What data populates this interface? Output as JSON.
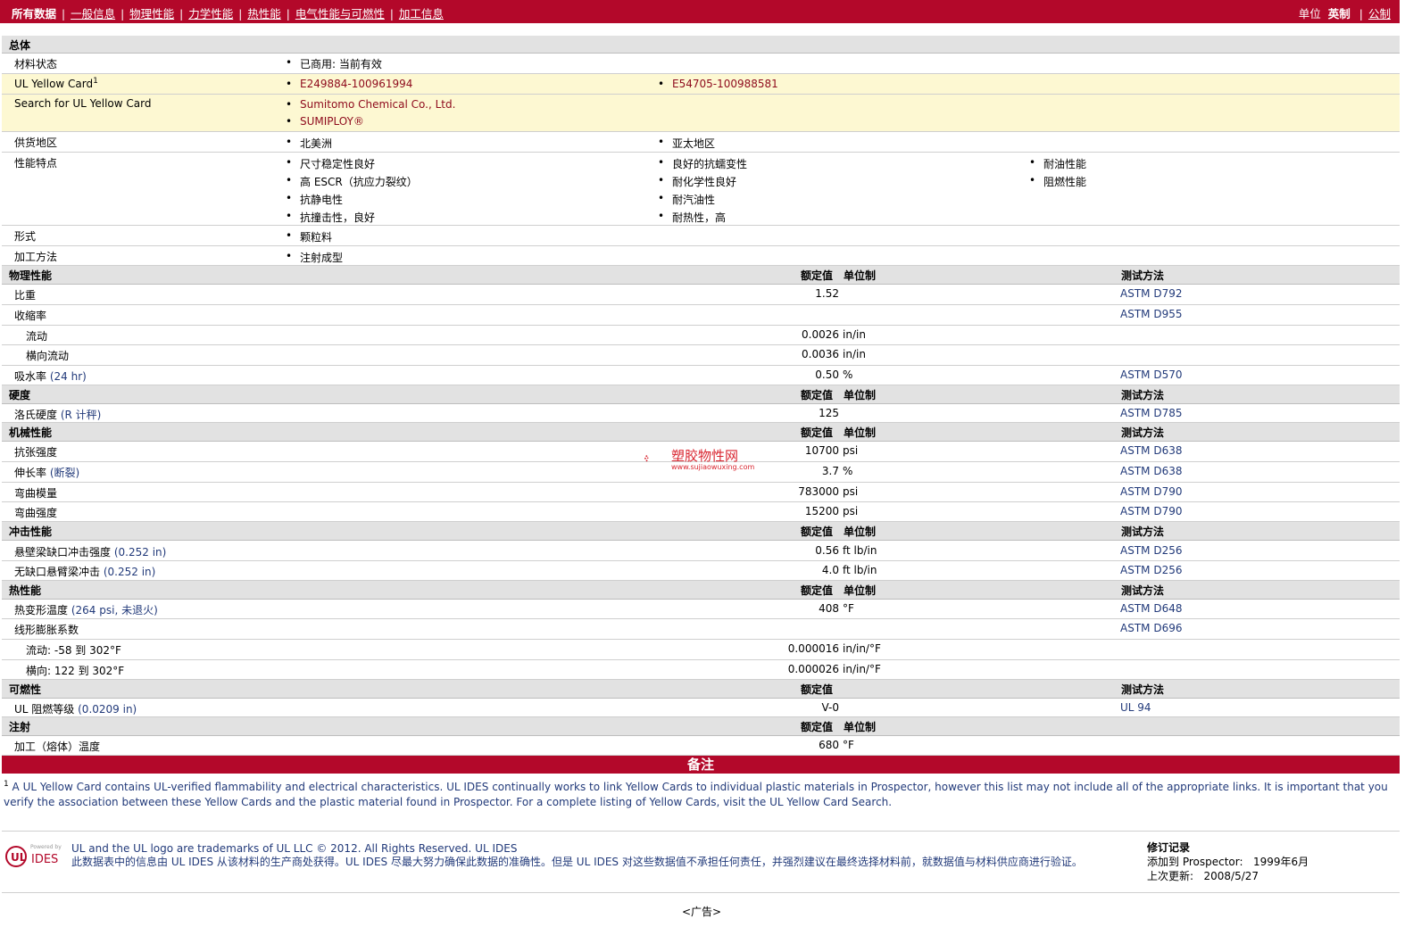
{
  "nav": {
    "tabs": [
      "所有数据",
      "一般信息",
      "物理性能",
      "力学性能",
      "热性能",
      "电气性能与可燃性",
      "加工信息"
    ],
    "units_label": "单位",
    "unit_active": "英制",
    "unit_other": "公制"
  },
  "general": {
    "title": "总体",
    "material_status": {
      "label": "材料状态",
      "value": "已商用: 当前有效"
    },
    "yellow_card": {
      "label": "UL Yellow Card",
      "sup": "1",
      "links": [
        "E249884-100961994",
        "E54705-100988581"
      ]
    },
    "search_card": {
      "label": "Search for UL Yellow Card",
      "links": [
        "Sumitomo Chemical Co., Ltd.",
        "SUMIPLOY®"
      ]
    },
    "supply_region": {
      "label": "供货地区",
      "values": [
        "北美洲",
        "亚太地区"
      ]
    },
    "features": {
      "label": "性能特点",
      "col1": [
        "尺寸稳定性良好",
        "高  ESCR（抗应力裂纹）",
        "抗静电性",
        "抗撞击性，良好"
      ],
      "col2": [
        "良好的抗蠕变性",
        "耐化学性良好",
        "耐汽油性",
        "耐热性，高"
      ],
      "col3": [
        "耐油性能",
        "阻燃性能"
      ]
    },
    "form": {
      "label": "形式",
      "value": "颗粒料"
    },
    "processing": {
      "label": "加工方法",
      "value": "注射成型"
    }
  },
  "headers": {
    "value": "额定值",
    "unit": "单位制",
    "method": "测试方法"
  },
  "physical": {
    "title": "物理性能",
    "rows": [
      {
        "label": "比重",
        "cond": "",
        "value": "1.52",
        "unit": "",
        "method": "ASTM D792"
      },
      {
        "label": "收缩率",
        "cond": "",
        "value": "",
        "unit": "",
        "method": "ASTM D955"
      },
      {
        "label": "流动",
        "cond": "",
        "value": "0.0026",
        "unit": "in/in",
        "method": ""
      },
      {
        "label": "横向流动",
        "cond": "",
        "value": "0.0036",
        "unit": "in/in",
        "method": ""
      },
      {
        "label": "吸水率",
        "cond": "(24 hr)",
        "value": "0.50",
        "unit": "%",
        "method": "ASTM D570"
      }
    ]
  },
  "hardness": {
    "title": "硬度",
    "rows": [
      {
        "label": "洛氏硬度",
        "cond": "(R 计秤)",
        "value": "125",
        "unit": "",
        "method": "ASTM D785"
      }
    ]
  },
  "mechanical": {
    "title": "机械性能",
    "rows": [
      {
        "label": "抗张强度",
        "cond": "",
        "value": "10700",
        "unit": "psi",
        "method": "ASTM D638"
      },
      {
        "label": "伸长率",
        "cond": "(断裂)",
        "value": "3.7",
        "unit": "%",
        "method": "ASTM D638"
      },
      {
        "label": "弯曲模量",
        "cond": "",
        "value": "783000",
        "unit": "psi",
        "method": "ASTM D790"
      },
      {
        "label": "弯曲强度",
        "cond": "",
        "value": "15200",
        "unit": "psi",
        "method": "ASTM D790"
      }
    ]
  },
  "impact": {
    "title": "冲击性能",
    "rows": [
      {
        "label": "悬壁梁缺口冲击强度",
        "cond": "(0.252 in)",
        "value": "0.56",
        "unit": "ft lb/in",
        "method": "ASTM D256"
      },
      {
        "label": "无缺口悬臂梁冲击",
        "cond": "(0.252 in)",
        "value": "4.0",
        "unit": "ft lb/in",
        "method": "ASTM D256"
      }
    ]
  },
  "thermal": {
    "title": "热性能",
    "rows": [
      {
        "label": "热变形温度",
        "cond": "(264 psi, 未退火)",
        "value": "408",
        "unit": "°F",
        "method": "ASTM D648"
      },
      {
        "label": "线形膨胀系数",
        "cond": "",
        "value": "",
        "unit": "",
        "method": "ASTM D696"
      },
      {
        "label": "流动: -58 到  302°F",
        "cond": "",
        "value": "0.000016",
        "unit": "in/in/°F",
        "method": ""
      },
      {
        "label": "横向: 122 到  302°F",
        "cond": "",
        "value": "0.000026",
        "unit": "in/in/°F",
        "method": ""
      }
    ]
  },
  "flammability": {
    "title": "可燃性",
    "rows": [
      {
        "label": "UL 阻燃等级",
        "cond": "(0.0209 in)",
        "value": "V-0",
        "unit": "",
        "method": "UL 94"
      }
    ]
  },
  "injection": {
    "title": "注射",
    "rows": [
      {
        "label": "加工（熔体）温度",
        "cond": "",
        "value": "680",
        "unit": "°F",
        "method": ""
      }
    ]
  },
  "notes": {
    "title": "备注",
    "sup": "1",
    "text": " A UL Yellow Card contains UL-verified flammability and electrical characteristics. UL IDES continually works to link Yellow Cards to individual plastic materials in Prospector, however this list may not include all of the appropriate links. It is important that you verify the association between these Yellow Cards and the plastic material found in Prospector. For a complete listing of Yellow Cards, visit the UL Yellow Card Search."
  },
  "footer": {
    "logo_top": "Powered by",
    "logo_text": "IDES",
    "line1": "UL and the UL logo are trademarks of UL LLC © 2012. All Rights Reserved. UL IDES",
    "line2": "此数据表中的信息由  UL IDES 从该材料的生产商处获得。UL IDES 尽最大努力确保此数据的准确性。但是  UL IDES 对这些数据值不承担任何责任，并强烈建议在最终选择材料前，就数据值与材料供应商进行验证。",
    "rev_title": "修订记录",
    "rev_added_label": "添加到  Prospector:",
    "rev_added_value": "1999年6月",
    "rev_updated_label": "上次更新:",
    "rev_updated_value": "2008/5/27",
    "ad": "<广告>"
  },
  "watermark": {
    "text": "塑胶物性网",
    "sub": "www.sujiaowuxing.com"
  },
  "colors": {
    "brand_red": "#b3082a",
    "link_red": "#8e0a1c",
    "link_blue": "#223a7a",
    "yellow_row": "#fdf8d2",
    "section_gray": "#e2e2e2"
  }
}
